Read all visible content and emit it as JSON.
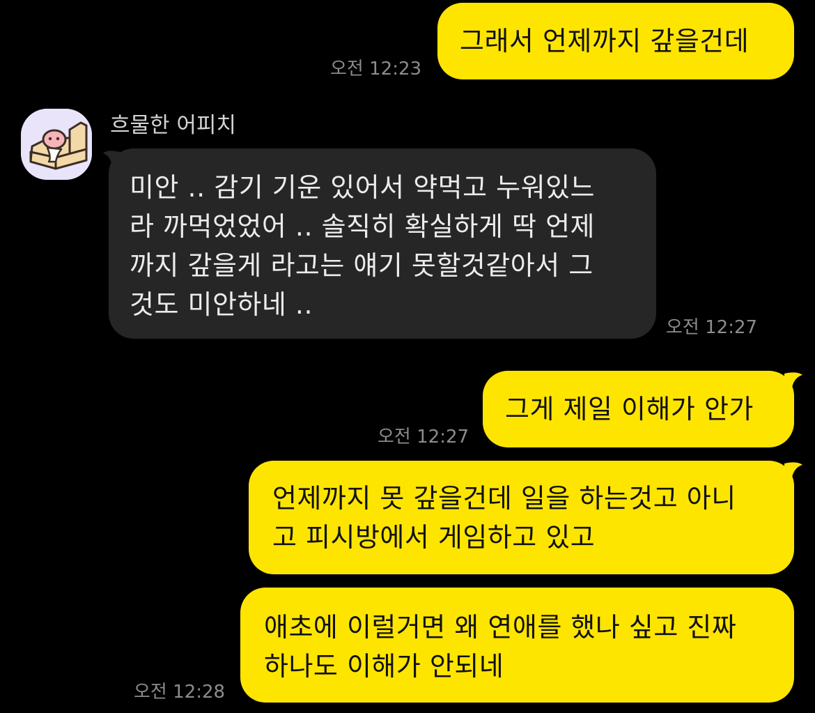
{
  "sender": {
    "name": "흐물한 어피치",
    "avatar_icon": "apeach-sofa-icon"
  },
  "colors": {
    "background": "#000000",
    "my_bubble": "#FEE500",
    "their_bubble": "#262626",
    "timestamp": "#8C8C8C"
  },
  "messages": [
    {
      "from": "me",
      "text": "그래서 언제까지 갚을건데",
      "time": "오전 12:23"
    },
    {
      "from": "other",
      "text": "미안 .. 감기 기운 있어서 약먹고 누워있느\n라 까먹었었어 .. 솔직히 확실하게 딱 언제\n까지 갚을게 라고는 얘기 못할것같아서 그\n것도 미안하네 ..",
      "time": "오전 12:27"
    },
    {
      "from": "me",
      "text": "그게 제일 이해가 안가",
      "time": "오전 12:27"
    },
    {
      "from": "me",
      "text": "언제까지 못 갚을건데 일을 하는것고 아니\n고 피시방에서 게임하고 있고",
      "time": ""
    },
    {
      "from": "me",
      "text": "애초에 이럴거면 왜 연애를 했나 싶고 진짜\n하나도 이해가 안되네",
      "time": "오전 12:28"
    }
  ]
}
